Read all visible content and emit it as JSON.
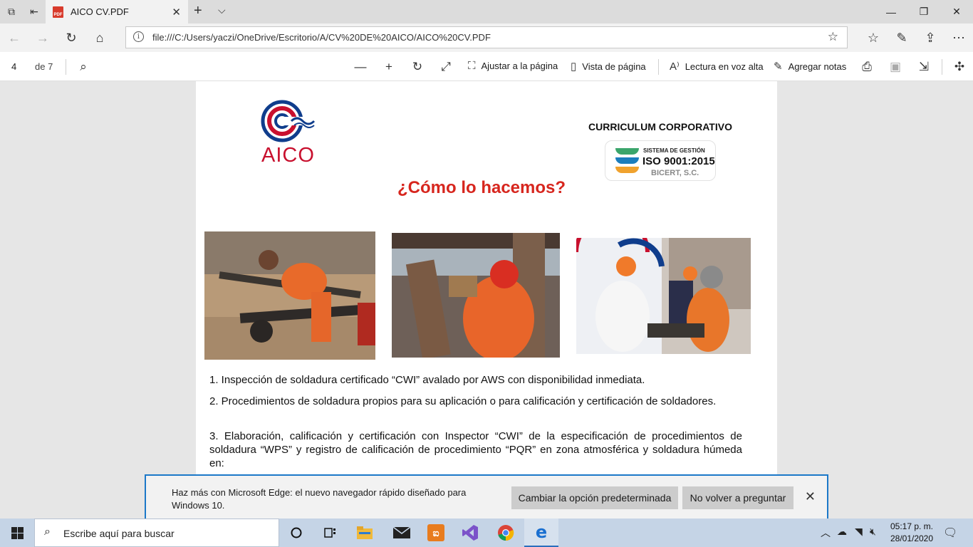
{
  "tab": {
    "title": "AICO CV.PDF",
    "close": "✕"
  },
  "address": {
    "url": "file:///C:/Users/yaczi/OneDrive/Escritorio/A/CV%20DE%20AICO/AICO%20CV.PDF"
  },
  "pdf_toolbar": {
    "page": "4",
    "of_pages": "de 7",
    "fit_page": "Ajustar a la página",
    "page_view": "Vista de página",
    "read_aloud": "Lectura en voz alta",
    "add_notes": "Agregar notas"
  },
  "document": {
    "logo_text": "AICO",
    "corp_title": "CURRICULUM CORPORATIVO",
    "iso": {
      "line1": "SISTEMA DE GESTIÓN",
      "line2": "ISO 9001:2015",
      "line3": "BICERT, S.C."
    },
    "heading": "¿Cómo lo hacemos?",
    "paragraphs": [
      "1. Inspección de soldadura certificado “CWI” avalado por AWS con disponibilidad inmediata.",
      "2. Procedimientos de soldadura propios para su aplicación o para calificación y certificación de soldadores.",
      "3. Elaboración, calificación y certificación con Inspector “CWI” de la especificación de procedimientos de soldadura “WPS” y registro de calificación de procedimiento “PQR” en zona atmosférica y soldadura húmeda en:"
    ]
  },
  "notification": {
    "message": "Haz más con Microsoft Edge: el nuevo navegador rápido diseñado para Windows 10.",
    "change_default": "Cambiar la opción predeterminada",
    "dont_ask": "No volver a preguntar",
    "close": "✕"
  },
  "taskbar": {
    "search_placeholder": "Escribe aquí para buscar",
    "time": "05:17 p. m.",
    "date": "28/01/2020"
  },
  "colors": {
    "accent": "#1b78c8",
    "heading_red": "#d7261e",
    "aico_blue": "#0f3d8c",
    "aico_red": "#c8102e"
  }
}
